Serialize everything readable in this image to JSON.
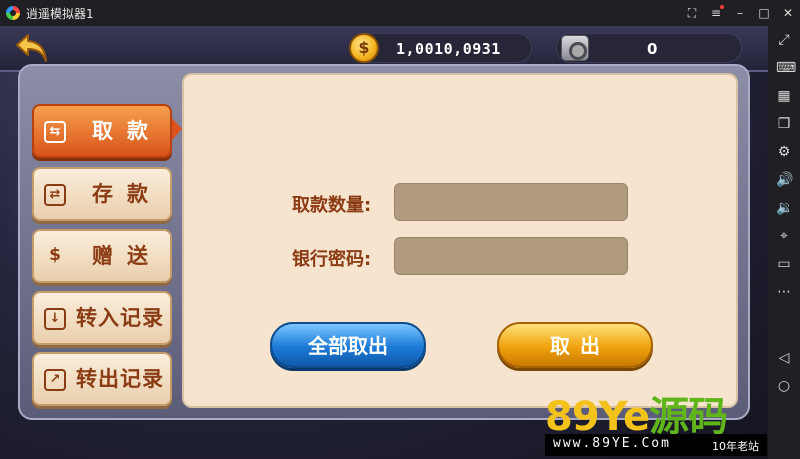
{
  "window": {
    "title": "逍遥模拟器1"
  },
  "topbar": {
    "coin_value": "1,0010,0931",
    "safe_value": "0",
    "coin_symbol": "$"
  },
  "tabs": [
    {
      "label": "取款",
      "icon": "withdraw-icon",
      "active": true
    },
    {
      "label": "存款",
      "icon": "deposit-icon",
      "active": false
    },
    {
      "label": "赠送",
      "icon": "gift-money-icon",
      "active": false
    },
    {
      "label": "转入记录",
      "icon": "transfer-in-icon",
      "active": false
    },
    {
      "label": "转出记录",
      "icon": "transfer-out-icon",
      "active": false
    }
  ],
  "form": {
    "amount_label": "取款数量:",
    "password_label": "银行密码:",
    "amount_value": "",
    "password_value": ""
  },
  "buttons": {
    "withdraw_all": "全部取出",
    "withdraw": "取出"
  },
  "watermark": {
    "brand_main": "89Ye",
    "brand_cn": "源码",
    "url": "www.89YE.Com",
    "tag": "10年老站"
  },
  "colors": {
    "active_tab": "#d9531a",
    "label_brown": "#8b3c14",
    "blue_button": "#1d7ad8",
    "gold_button": "#f0a20e"
  }
}
